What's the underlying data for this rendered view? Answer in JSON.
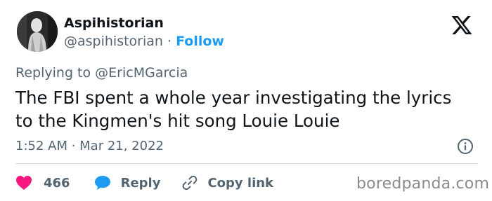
{
  "author": {
    "display_name": "Aspihistorian",
    "handle": "@aspihistorian",
    "separator": "·",
    "follow_label": "Follow"
  },
  "reply_context": {
    "prefix": "Replying to",
    "mention": "@EricMGarcia"
  },
  "tweet": {
    "text": "The FBI spent a whole year investigating the lyrics\nto the Kingmen's hit song  Louie Louie",
    "timestamp": "1:52 AM · Mar 21, 2022"
  },
  "actions": {
    "likes_count": "466",
    "reply_label": "Reply",
    "copy_link_label": "Copy link"
  },
  "icons": {
    "platform_logo": "x-logo-icon",
    "info": "info-icon",
    "like": "heart-icon",
    "reply": "reply-bubble-icon",
    "copy_link": "link-icon"
  },
  "colors": {
    "like": "#f91880",
    "reply": "#1d9bf0",
    "follow": "#1d9bf0",
    "secondary_text": "#536471",
    "primary_text": "#0f1419"
  },
  "watermark": "boredpanda.com"
}
